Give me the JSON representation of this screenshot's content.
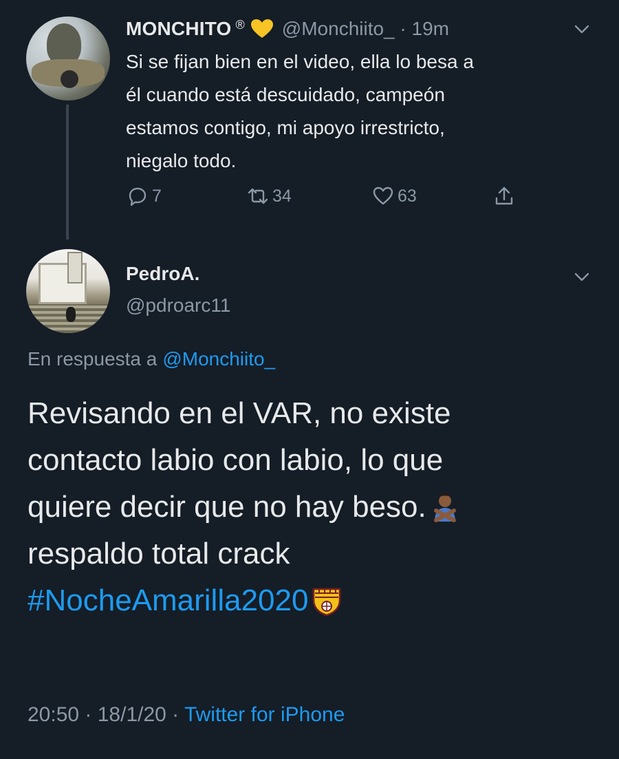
{
  "tweet1": {
    "name": "MONCHITO",
    "registered": "®",
    "handle_time": "@Monchiito_ · 19m",
    "body": "Si se fijan bien en el video, ella lo besa a\nél cuando está descuidado, campeón\nestamos contigo, mi apoyo irrestricto,\nniegalo todo.",
    "replies": "7",
    "retweets": "34",
    "likes": "63",
    "heart_emoji": "yellow-heart"
  },
  "tweet2": {
    "name": "PedroA.",
    "handle": "@pdroarc11",
    "reply_to_label": "En respuesta a",
    "reply_to_handle": "@Monchiito_",
    "lines": [
      "Revisando en el VAR, no existe",
      "contacto labio con labio, lo que",
      "quiere decir que no hay beso.",
      "respaldo total crack"
    ],
    "hashtag": "#NocheAmarilla2020",
    "timestamp": "20:50 · 18/1/20 · ",
    "client": "Twitter for iPhone"
  },
  "colors": {
    "background": "#151d27",
    "text": "#e7e9ea",
    "secondary": "#8b98a5",
    "accent": "#1d9bf0",
    "heart": "#f7c325"
  }
}
